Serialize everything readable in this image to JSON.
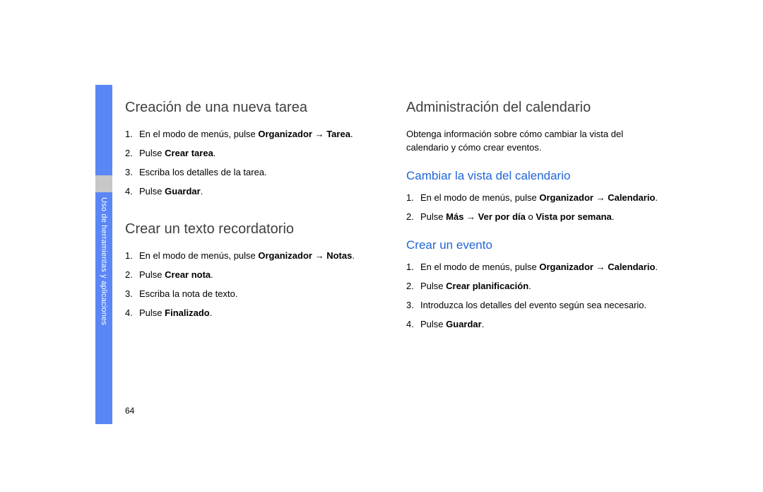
{
  "side_label": "Uso de herramientas y aplicaciones",
  "page_number": "64",
  "left": {
    "section1": {
      "title": "Creación de una nueva tarea",
      "s1_pre": "En el modo de menús, pulse ",
      "s1_b1": "Organizador",
      "s1_arrow": " → ",
      "s1_b2": "Tarea",
      "s1_post": ".",
      "s2_pre": "Pulse ",
      "s2_b": "Crear tarea",
      "s2_post": ".",
      "s3": "Escriba los detalles de la tarea.",
      "s4_pre": "Pulse ",
      "s4_b": "Guardar",
      "s4_post": "."
    },
    "section2": {
      "title": "Crear un texto recordatorio",
      "s1_pre": "En el modo de menús, pulse ",
      "s1_b1": "Organizador",
      "s1_arrow": " → ",
      "s1_b2": "Notas",
      "s1_post": ".",
      "s2_pre": "Pulse ",
      "s2_b": "Crear nota",
      "s2_post": ".",
      "s3": "Escriba la nota de texto.",
      "s4_pre": "Pulse ",
      "s4_b": "Finalizado",
      "s4_post": "."
    }
  },
  "right": {
    "section1": {
      "title": "Administración del calendario",
      "intro": "Obtenga información sobre cómo cambiar la vista del calendario y cómo crear eventos."
    },
    "sub1": {
      "title": "Cambiar la vista del calendario",
      "s1_pre": "En el modo de menús, pulse ",
      "s1_b1": "Organizador",
      "s1_arrow": " → ",
      "s1_b2": "Calendario",
      "s1_post": ".",
      "s2_pre": "Pulse ",
      "s2_b1": "Más",
      "s2_mid1": " → ",
      "s2_b2": "Ver por día",
      "s2_mid2": " o ",
      "s2_b3": "Vista por semana",
      "s2_post": "."
    },
    "sub2": {
      "title": "Crear un evento",
      "s1_pre": "En el modo de menús, pulse ",
      "s1_b1": "Organizador",
      "s1_arrow": " → ",
      "s1_b2": "Calendario",
      "s1_post": ".",
      "s2_pre": "Pulse ",
      "s2_b": "Crear planificación",
      "s2_post": ".",
      "s3": "Introduzca los detalles del evento según sea necesario.",
      "s4_pre": "Pulse ",
      "s4_b": "Guardar",
      "s4_post": "."
    }
  }
}
